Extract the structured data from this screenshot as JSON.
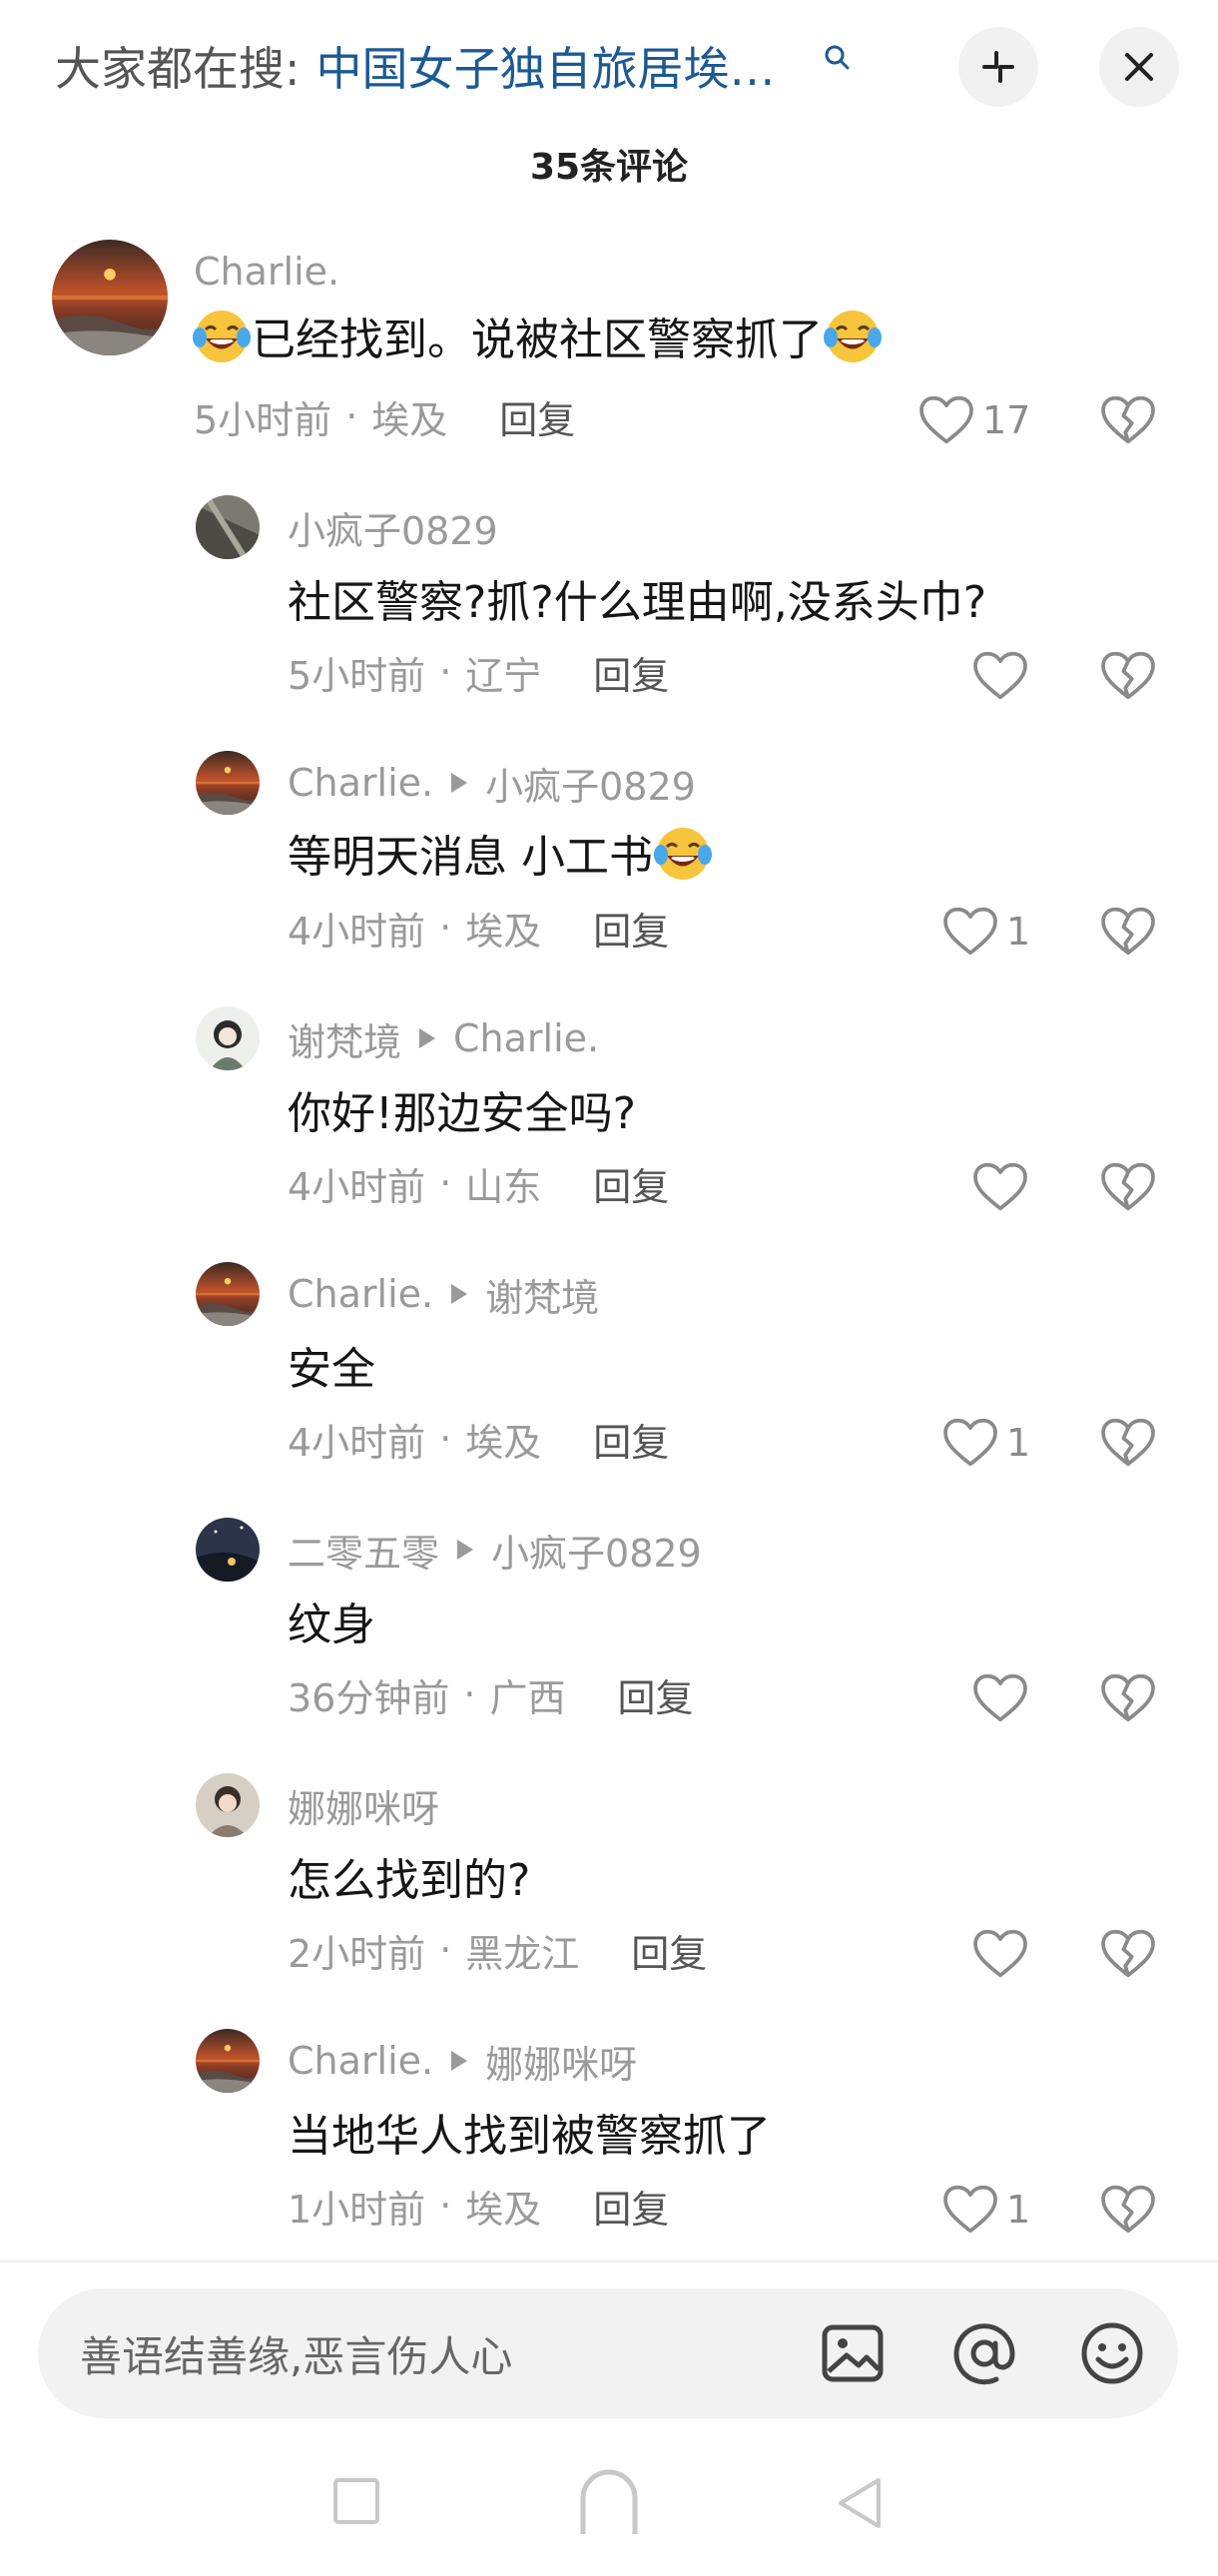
{
  "header": {
    "search_prefix": "大家都在搜:",
    "search_query": "中国女子独自旅居埃…",
    "comment_count": "35条评论"
  },
  "comments": [
    {
      "user": "Charlie.",
      "reply_to": "",
      "text_before": "",
      "text": "已经找到。说被社区警察抓了",
      "time": "5小时前",
      "location": "埃及",
      "reply_label": "回复",
      "likes": "17",
      "avatar": "sunset-avatar"
    },
    {
      "user": "小疯子0829",
      "reply_to": "",
      "text": "社区警察?抓?什么理由啊,没系头巾?",
      "time": "5小时前",
      "location": "辽宁",
      "reply_label": "回复",
      "likes": "",
      "avatar": "rock-avatar"
    },
    {
      "user": "Charlie.",
      "reply_to": "小疯子0829",
      "text": "等明天消息 小工书",
      "time": "4小时前",
      "location": "埃及",
      "reply_label": "回复",
      "likes": "1",
      "avatar": "sunset-avatar"
    },
    {
      "user": "谢梵境",
      "reply_to": "Charlie.",
      "text": "你好!那边安全吗?",
      "time": "4小时前",
      "location": "山东",
      "reply_label": "回复",
      "likes": "",
      "avatar": "sketch-avatar"
    },
    {
      "user": "Charlie.",
      "reply_to": "谢梵境",
      "text": "安全",
      "time": "4小时前",
      "location": "埃及",
      "reply_label": "回复",
      "likes": "1",
      "avatar": "sunset-avatar"
    },
    {
      "user": "二零五零",
      "reply_to": "小疯子0829",
      "text": "纹身",
      "time": "36分钟前",
      "location": "广西",
      "reply_label": "回复",
      "likes": "",
      "avatar": "night-avatar"
    },
    {
      "user": "娜娜咪呀",
      "reply_to": "",
      "text": "怎么找到的?",
      "time": "2小时前",
      "location": "黑龙江",
      "reply_label": "回复",
      "likes": "",
      "avatar": "girl-avatar"
    },
    {
      "user": "Charlie.",
      "reply_to": "娜娜咪呀",
      "text": "当地华人找到被警察抓了",
      "time": "1小时前",
      "location": "埃及",
      "reply_label": "回复",
      "likes": "1",
      "avatar": "sunset-avatar"
    }
  ],
  "input": {
    "placeholder": "善语结善缘,恶言伤人心"
  },
  "meta_separator": "·",
  "colors": {
    "query_blue": "#1c5a93",
    "muted_gray": "#9a9a9a",
    "input_bg": "#f2f2f2"
  }
}
